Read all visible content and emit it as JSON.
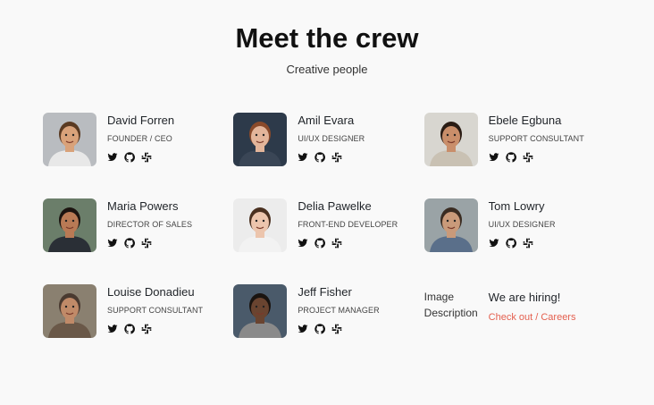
{
  "header": {
    "title": "Meet the crew",
    "subtitle": "Creative people"
  },
  "team": [
    {
      "name": "David Forren",
      "role": "Founder / CEO",
      "skin": "#d9a27a",
      "hair": "#5a3a22",
      "bg": "#b9bcc0",
      "shirt": "#e8e8e8"
    },
    {
      "name": "Amil Evara",
      "role": "UI/UX Designer",
      "skin": "#e3b59a",
      "hair": "#8a4a2a",
      "bg": "#2d3a4a",
      "shirt": "#3a4656"
    },
    {
      "name": "Ebele Egbuna",
      "role": "Support Consultant",
      "skin": "#c98e6a",
      "hair": "#2a1c14",
      "bg": "#d8d6d0",
      "shirt": "#c9c1b3"
    },
    {
      "name": "Maria Powers",
      "role": "Director of Sales",
      "skin": "#b97a55",
      "hair": "#1c1410",
      "bg": "#6b7e6a",
      "shirt": "#2a2f36"
    },
    {
      "name": "Delia Pawelke",
      "role": "Front-end Developer",
      "skin": "#ecc5ad",
      "hair": "#4a3020",
      "bg": "#ececec",
      "shirt": "#f2f2f2"
    },
    {
      "name": "Tom Lowry",
      "role": "UI/UX Designer",
      "skin": "#c99a7a",
      "hair": "#3a2c22",
      "bg": "#9aa3a6",
      "shirt": "#5a6f8a"
    },
    {
      "name": "Louise Donadieu",
      "role": "Support Consultant",
      "skin": "#c08a68",
      "hair": "#4a3a30",
      "bg": "#8a8070",
      "shirt": "#6a5848"
    },
    {
      "name": "Jeff Fisher",
      "role": "Project Manager",
      "skin": "#6a4430",
      "hair": "#1a1410",
      "bg": "#4a5a6a",
      "shirt": "#8a8a8a"
    }
  ],
  "hiring": {
    "image_alt": "Image Description",
    "title": "We are hiring!",
    "link": "Check out / Careers"
  },
  "social_icons": [
    "twitter-icon",
    "github-icon",
    "slack-icon"
  ],
  "colors": {
    "link": "#e4604f",
    "background": "#f9f9f9"
  }
}
